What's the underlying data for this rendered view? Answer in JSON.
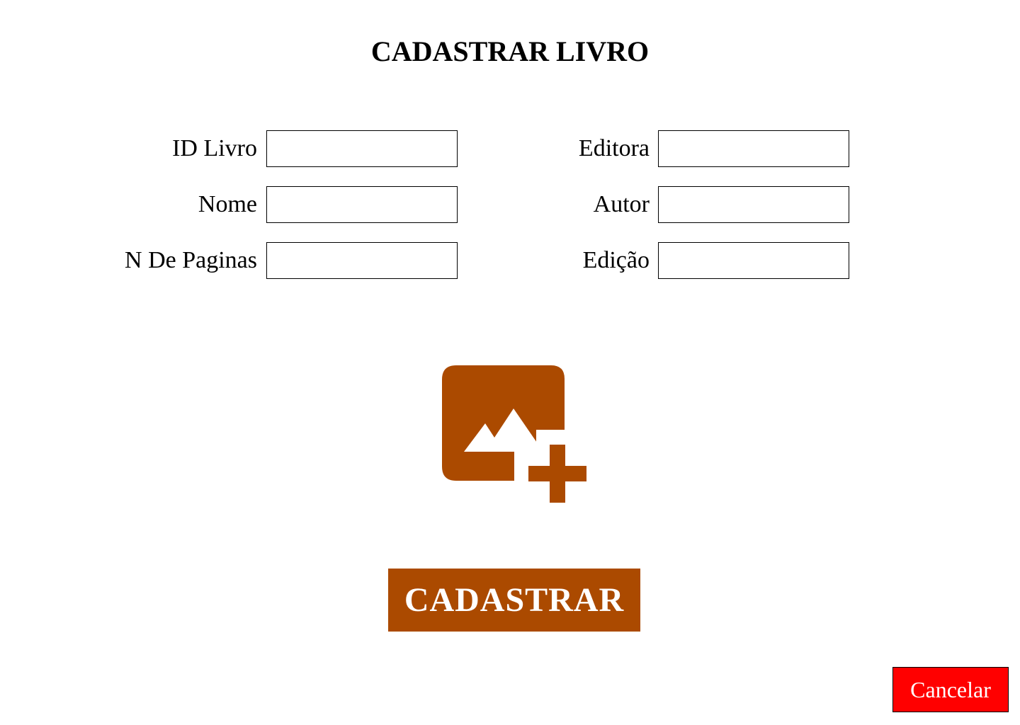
{
  "page": {
    "title": "CADASTRAR LIVRO"
  },
  "form": {
    "left_fields": [
      {
        "label": "ID Livro",
        "value": "",
        "placeholder": ""
      },
      {
        "label": "Nome",
        "value": "",
        "placeholder": ""
      },
      {
        "label": "N De Paginas",
        "value": "",
        "placeholder": ""
      }
    ],
    "right_fields": [
      {
        "label": "Editora",
        "value": "",
        "placeholder": ""
      },
      {
        "label": "Autor",
        "value": "",
        "placeholder": ""
      },
      {
        "label": "Edição",
        "value": "",
        "placeholder": ""
      }
    ]
  },
  "image_upload": {
    "icon": "add-image-icon"
  },
  "actions": {
    "submit_label": "CADASTRAR",
    "cancel_label": "Cancelar"
  },
  "colors": {
    "accent": "#ab4a00",
    "cancel": "#ff0000",
    "background": "#ffffff"
  }
}
